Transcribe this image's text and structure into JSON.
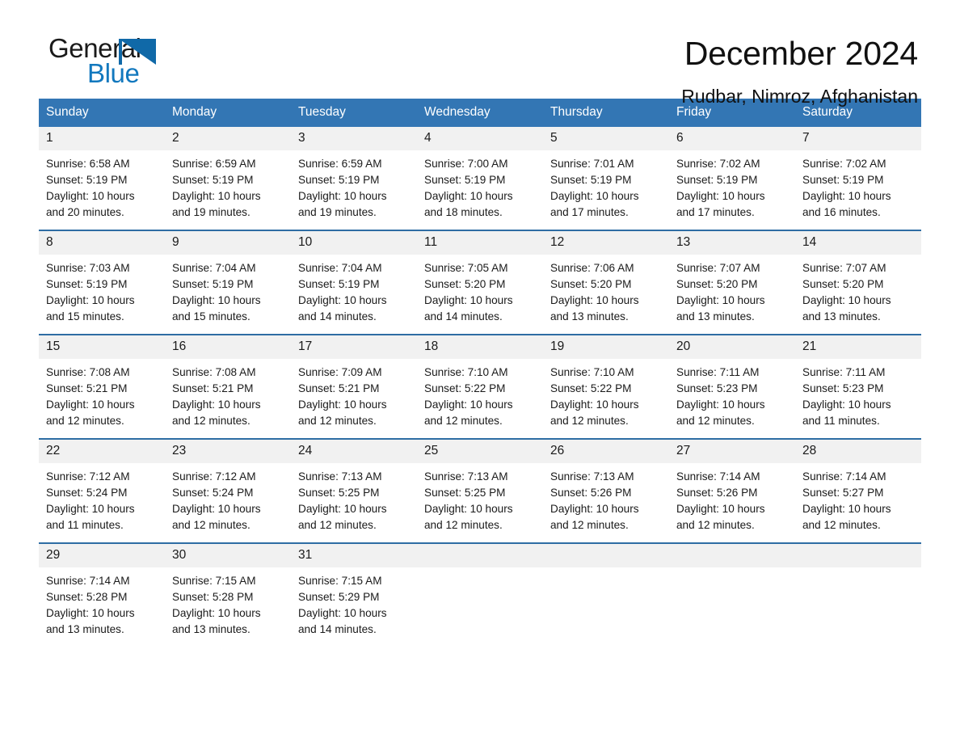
{
  "brand": {
    "line1": "General",
    "line2": "Blue",
    "triangle_icon": "triangle-logo-icon",
    "accent_color": "#1278be"
  },
  "header": {
    "title": "December 2024",
    "subtitle": "Rudbar, Nimroz, Afghanistan"
  },
  "theme": {
    "header_blue": "#3376b4",
    "row_border_blue": "#2e6da4",
    "daynum_gray": "#f1f1f1"
  },
  "weekdays": [
    "Sunday",
    "Monday",
    "Tuesday",
    "Wednesday",
    "Thursday",
    "Friday",
    "Saturday"
  ],
  "weeks": [
    [
      {
        "day": "1",
        "sunrise": "Sunrise: 6:58 AM",
        "sunset": "Sunset: 5:19 PM",
        "daylight1": "Daylight: 10 hours",
        "daylight2": "and 20 minutes."
      },
      {
        "day": "2",
        "sunrise": "Sunrise: 6:59 AM",
        "sunset": "Sunset: 5:19 PM",
        "daylight1": "Daylight: 10 hours",
        "daylight2": "and 19 minutes."
      },
      {
        "day": "3",
        "sunrise": "Sunrise: 6:59 AM",
        "sunset": "Sunset: 5:19 PM",
        "daylight1": "Daylight: 10 hours",
        "daylight2": "and 19 minutes."
      },
      {
        "day": "4",
        "sunrise": "Sunrise: 7:00 AM",
        "sunset": "Sunset: 5:19 PM",
        "daylight1": "Daylight: 10 hours",
        "daylight2": "and 18 minutes."
      },
      {
        "day": "5",
        "sunrise": "Sunrise: 7:01 AM",
        "sunset": "Sunset: 5:19 PM",
        "daylight1": "Daylight: 10 hours",
        "daylight2": "and 17 minutes."
      },
      {
        "day": "6",
        "sunrise": "Sunrise: 7:02 AM",
        "sunset": "Sunset: 5:19 PM",
        "daylight1": "Daylight: 10 hours",
        "daylight2": "and 17 minutes."
      },
      {
        "day": "7",
        "sunrise": "Sunrise: 7:02 AM",
        "sunset": "Sunset: 5:19 PM",
        "daylight1": "Daylight: 10 hours",
        "daylight2": "and 16 minutes."
      }
    ],
    [
      {
        "day": "8",
        "sunrise": "Sunrise: 7:03 AM",
        "sunset": "Sunset: 5:19 PM",
        "daylight1": "Daylight: 10 hours",
        "daylight2": "and 15 minutes."
      },
      {
        "day": "9",
        "sunrise": "Sunrise: 7:04 AM",
        "sunset": "Sunset: 5:19 PM",
        "daylight1": "Daylight: 10 hours",
        "daylight2": "and 15 minutes."
      },
      {
        "day": "10",
        "sunrise": "Sunrise: 7:04 AM",
        "sunset": "Sunset: 5:19 PM",
        "daylight1": "Daylight: 10 hours",
        "daylight2": "and 14 minutes."
      },
      {
        "day": "11",
        "sunrise": "Sunrise: 7:05 AM",
        "sunset": "Sunset: 5:20 PM",
        "daylight1": "Daylight: 10 hours",
        "daylight2": "and 14 minutes."
      },
      {
        "day": "12",
        "sunrise": "Sunrise: 7:06 AM",
        "sunset": "Sunset: 5:20 PM",
        "daylight1": "Daylight: 10 hours",
        "daylight2": "and 13 minutes."
      },
      {
        "day": "13",
        "sunrise": "Sunrise: 7:07 AM",
        "sunset": "Sunset: 5:20 PM",
        "daylight1": "Daylight: 10 hours",
        "daylight2": "and 13 minutes."
      },
      {
        "day": "14",
        "sunrise": "Sunrise: 7:07 AM",
        "sunset": "Sunset: 5:20 PM",
        "daylight1": "Daylight: 10 hours",
        "daylight2": "and 13 minutes."
      }
    ],
    [
      {
        "day": "15",
        "sunrise": "Sunrise: 7:08 AM",
        "sunset": "Sunset: 5:21 PM",
        "daylight1": "Daylight: 10 hours",
        "daylight2": "and 12 minutes."
      },
      {
        "day": "16",
        "sunrise": "Sunrise: 7:08 AM",
        "sunset": "Sunset: 5:21 PM",
        "daylight1": "Daylight: 10 hours",
        "daylight2": "and 12 minutes."
      },
      {
        "day": "17",
        "sunrise": "Sunrise: 7:09 AM",
        "sunset": "Sunset: 5:21 PM",
        "daylight1": "Daylight: 10 hours",
        "daylight2": "and 12 minutes."
      },
      {
        "day": "18",
        "sunrise": "Sunrise: 7:10 AM",
        "sunset": "Sunset: 5:22 PM",
        "daylight1": "Daylight: 10 hours",
        "daylight2": "and 12 minutes."
      },
      {
        "day": "19",
        "sunrise": "Sunrise: 7:10 AM",
        "sunset": "Sunset: 5:22 PM",
        "daylight1": "Daylight: 10 hours",
        "daylight2": "and 12 minutes."
      },
      {
        "day": "20",
        "sunrise": "Sunrise: 7:11 AM",
        "sunset": "Sunset: 5:23 PM",
        "daylight1": "Daylight: 10 hours",
        "daylight2": "and 12 minutes."
      },
      {
        "day": "21",
        "sunrise": "Sunrise: 7:11 AM",
        "sunset": "Sunset: 5:23 PM",
        "daylight1": "Daylight: 10 hours",
        "daylight2": "and 11 minutes."
      }
    ],
    [
      {
        "day": "22",
        "sunrise": "Sunrise: 7:12 AM",
        "sunset": "Sunset: 5:24 PM",
        "daylight1": "Daylight: 10 hours",
        "daylight2": "and 11 minutes."
      },
      {
        "day": "23",
        "sunrise": "Sunrise: 7:12 AM",
        "sunset": "Sunset: 5:24 PM",
        "daylight1": "Daylight: 10 hours",
        "daylight2": "and 12 minutes."
      },
      {
        "day": "24",
        "sunrise": "Sunrise: 7:13 AM",
        "sunset": "Sunset: 5:25 PM",
        "daylight1": "Daylight: 10 hours",
        "daylight2": "and 12 minutes."
      },
      {
        "day": "25",
        "sunrise": "Sunrise: 7:13 AM",
        "sunset": "Sunset: 5:25 PM",
        "daylight1": "Daylight: 10 hours",
        "daylight2": "and 12 minutes."
      },
      {
        "day": "26",
        "sunrise": "Sunrise: 7:13 AM",
        "sunset": "Sunset: 5:26 PM",
        "daylight1": "Daylight: 10 hours",
        "daylight2": "and 12 minutes."
      },
      {
        "day": "27",
        "sunrise": "Sunrise: 7:14 AM",
        "sunset": "Sunset: 5:26 PM",
        "daylight1": "Daylight: 10 hours",
        "daylight2": "and 12 minutes."
      },
      {
        "day": "28",
        "sunrise": "Sunrise: 7:14 AM",
        "sunset": "Sunset: 5:27 PM",
        "daylight1": "Daylight: 10 hours",
        "daylight2": "and 12 minutes."
      }
    ],
    [
      {
        "day": "29",
        "sunrise": "Sunrise: 7:14 AM",
        "sunset": "Sunset: 5:28 PM",
        "daylight1": "Daylight: 10 hours",
        "daylight2": "and 13 minutes."
      },
      {
        "day": "30",
        "sunrise": "Sunrise: 7:15 AM",
        "sunset": "Sunset: 5:28 PM",
        "daylight1": "Daylight: 10 hours",
        "daylight2": "and 13 minutes."
      },
      {
        "day": "31",
        "sunrise": "Sunrise: 7:15 AM",
        "sunset": "Sunset: 5:29 PM",
        "daylight1": "Daylight: 10 hours",
        "daylight2": "and 14 minutes."
      },
      {
        "day": "",
        "sunrise": "",
        "sunset": "",
        "daylight1": "",
        "daylight2": ""
      },
      {
        "day": "",
        "sunrise": "",
        "sunset": "",
        "daylight1": "",
        "daylight2": ""
      },
      {
        "day": "",
        "sunrise": "",
        "sunset": "",
        "daylight1": "",
        "daylight2": ""
      },
      {
        "day": "",
        "sunrise": "",
        "sunset": "",
        "daylight1": "",
        "daylight2": ""
      }
    ]
  ]
}
